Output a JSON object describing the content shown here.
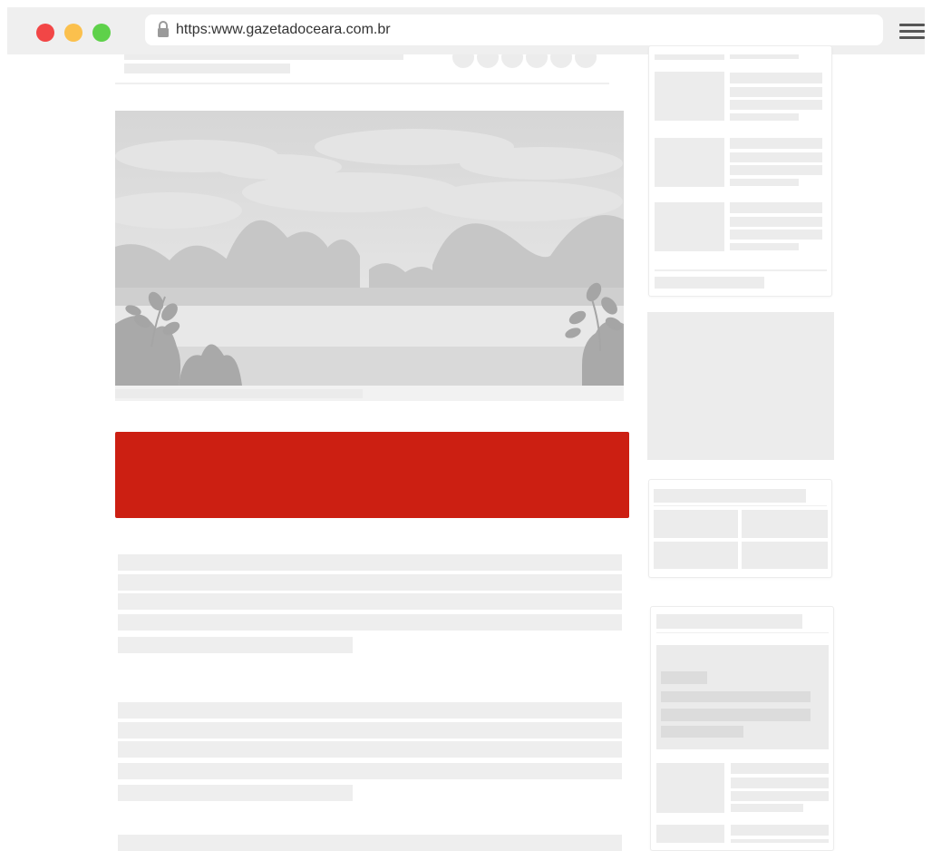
{
  "browser": {
    "url": "https:www.gazetadoceara.com.br",
    "traffic_lights": {
      "close": "#f24646",
      "minimize": "#fbc04d",
      "maximize": "#5ed14a"
    },
    "lock_icon": "lock-icon",
    "menu_icon": "hamburger-menu-icon"
  },
  "article": {
    "cta_color": "#cc1f12",
    "hero_image": "landscape-illustration"
  }
}
